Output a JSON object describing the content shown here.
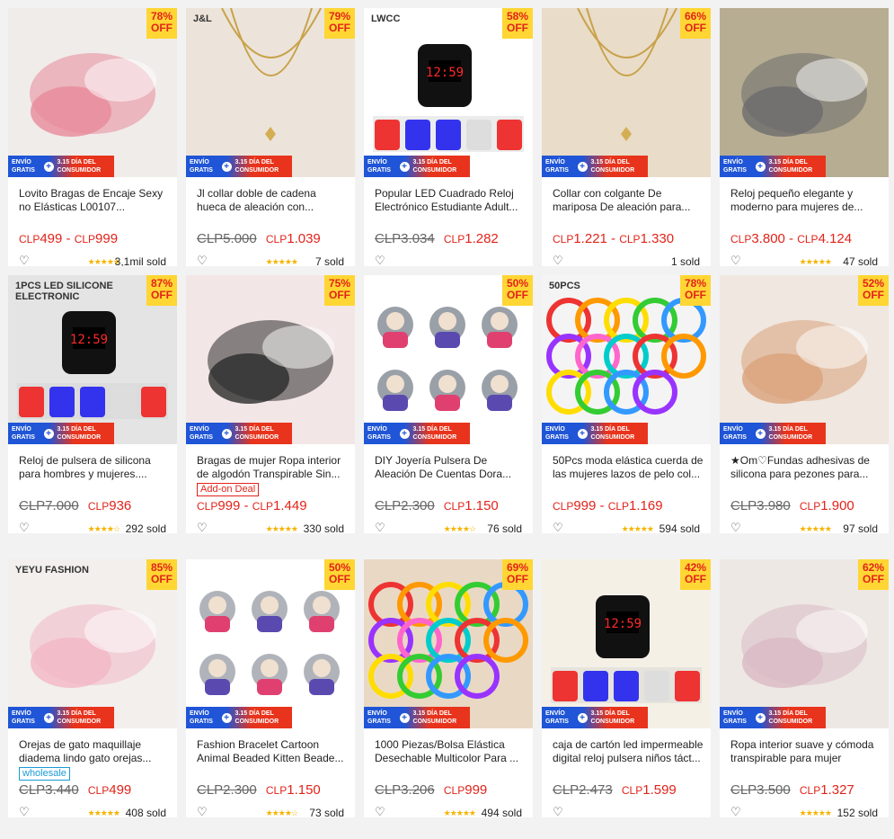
{
  "promo": {
    "line1": "ENVÍO GRATIS",
    "line2": "3.15 DÍA DEL CONSUMIDOR"
  },
  "products": [
    {
      "off": "78%",
      "off_label": "OFF",
      "title": "Lovito Bragas de Encaje Sexy no Elásticas L00107...",
      "price_cur": "CLP",
      "price": "499 - ",
      "price2_cur": "CLP",
      "price2": "999",
      "old": "",
      "tag": "",
      "rating": 5,
      "sold": "3,1mil sold",
      "bg": "#f0ece9",
      "accent": "#e88a9a"
    },
    {
      "off": "79%",
      "off_label": "OFF",
      "title": "Jl collar doble de cadena hueca de aleación con...",
      "price_cur": "CLP",
      "price": "1.039",
      "price2_cur": "",
      "price2": "",
      "old": "CLP5.000",
      "tag": "",
      "rating": 5,
      "sold": "7 sold",
      "bg": "#ece4da",
      "accent": "#c8a24a",
      "logo": "J&L"
    },
    {
      "off": "58%",
      "off_label": "OFF",
      "title": "Popular LED Cuadrado Reloj Electrónico Estudiante Adult...",
      "price_cur": "CLP",
      "price": "1.282",
      "price2_cur": "",
      "price2": "",
      "old": "CLP3.034",
      "tag": "",
      "rating": 0,
      "sold": "",
      "bg": "#ffffff",
      "accent": "#111111",
      "logo": "LWCC"
    },
    {
      "off": "66%",
      "off_label": "OFF",
      "title": "Collar con colgante De mariposa De aleación para...",
      "price_cur": "CLP",
      "price": "1.221 - ",
      "price2_cur": "CLP",
      "price2": "1.330",
      "old": "",
      "tag": "",
      "rating": 0,
      "sold": "1 sold",
      "bg": "#e9dcc8",
      "accent": "#3a2a20"
    },
    {
      "off": "",
      "off_label": "",
      "title": "Reloj pequeño elegante y moderno para mujeres de...",
      "price_cur": "CLP",
      "price": "3.800 - ",
      "price2_cur": "CLP",
      "price2": "4.124",
      "old": "",
      "tag": "",
      "rating": 5,
      "sold": "47 sold",
      "bg": "#b7ad92",
      "accent": "#6c6c6c"
    },
    {
      "off": "87%",
      "off_label": "OFF",
      "title": "Reloj de pulsera de silicona para hombres y mujeres....",
      "price_cur": "CLP",
      "price": "936",
      "price2_cur": "",
      "price2": "",
      "old": "CLP7.000",
      "tag": "",
      "rating": 4,
      "sold": "292 sold",
      "bg": "#e4e4e4",
      "accent": "#111111",
      "logo": "1PCS LED SILICONE ELECTRONIC"
    },
    {
      "off": "75%",
      "off_label": "OFF",
      "title": "Bragas de mujer Ropa interior de algodón Transpirable Sin...",
      "price_cur": "CLP",
      "price": "999 - ",
      "price2_cur": "CLP",
      "price2": "1.449",
      "old": "",
      "tag": "Add-on Deal",
      "tag_color": "#e2231a",
      "rating": 5,
      "sold": "330 sold",
      "bg": "#f3e6e6",
      "accent": "#2b2b2b"
    },
    {
      "off": "50%",
      "off_label": "OFF",
      "title": "DIY Joyería Pulsera De Aleación De Cuentas Dora...",
      "price_cur": "CLP",
      "price": "1.150",
      "price2_cur": "",
      "price2": "",
      "old": "CLP2.300",
      "tag": "",
      "rating": 4,
      "sold": "76 sold",
      "bg": "#ffffff",
      "accent": "#9aa0a8"
    },
    {
      "off": "78%",
      "off_label": "OFF",
      "title": "50Pcs moda elástica cuerda de las mujeres lazos de pelo col...",
      "price_cur": "CLP",
      "price": "999 - ",
      "price2_cur": "CLP",
      "price2": "1.169",
      "old": "",
      "tag": "",
      "rating": 5,
      "sold": "594 sold",
      "bg": "#f4f4f4",
      "accent": "#e0357a",
      "logo": "50PCS"
    },
    {
      "off": "52%",
      "off_label": "OFF",
      "title": "★Om♡Fundas adhesivas de silicona para pezones para...",
      "price_cur": "CLP",
      "price": "1.900",
      "price2_cur": "",
      "price2": "",
      "old": "CLP3.980",
      "tag": "",
      "rating": 5,
      "sold": "97 sold",
      "bg": "#efe7e0",
      "accent": "#d9a27a"
    },
    {
      "off": "85%",
      "off_label": "OFF",
      "title": "Orejas de gato maquillaje diadema lindo gato orejas...",
      "price_cur": "CLP",
      "price": "499",
      "price2_cur": "",
      "price2": "",
      "old": "CLP3.440",
      "tag": "wholesale",
      "tag_color": "#1a9ad6",
      "rating": 5,
      "sold": "408 sold",
      "bg": "#f2efec",
      "accent": "#f3b7c6",
      "logo": "YEYU FASHION"
    },
    {
      "off": "50%",
      "off_label": "OFF",
      "title": "Fashion Bracelet Cartoon Animal Beaded Kitten Beade...",
      "price_cur": "CLP",
      "price": "1.150",
      "price2_cur": "",
      "price2": "",
      "old": "CLP2.300",
      "tag": "",
      "rating": 4,
      "sold": "73 sold",
      "bg": "#ffffff",
      "accent": "#b0b4ba"
    },
    {
      "off": "69%",
      "off_label": "OFF",
      "title": "1000 Piezas/Bolsa Elástica Desechable Multicolor Para ...",
      "price_cur": "CLP",
      "price": "999",
      "price2_cur": "",
      "price2": "",
      "old": "CLP3.206",
      "tag": "",
      "rating": 5,
      "sold": "494 sold",
      "bg": "#e9d9c4",
      "accent": "#111111"
    },
    {
      "off": "42%",
      "off_label": "OFF",
      "title": "caja de cartón led impermeable digital reloj pulsera niños táct...",
      "price_cur": "CLP",
      "price": "1.599",
      "price2_cur": "",
      "price2": "",
      "old": "CLP2.473",
      "tag": "",
      "rating": 0,
      "sold": "",
      "bg": "#f5f0e6",
      "accent": "#e85a8a"
    },
    {
      "off": "62%",
      "off_label": "OFF",
      "title": "Ropa interior suave y cómoda transpirable para mujer",
      "price_cur": "CLP",
      "price": "1.327",
      "price2_cur": "",
      "price2": "",
      "old": "CLP3.500",
      "tag": "",
      "rating": 5,
      "sold": "152 sold",
      "bg": "#eee8e4",
      "accent": "#d9b9c4"
    }
  ]
}
